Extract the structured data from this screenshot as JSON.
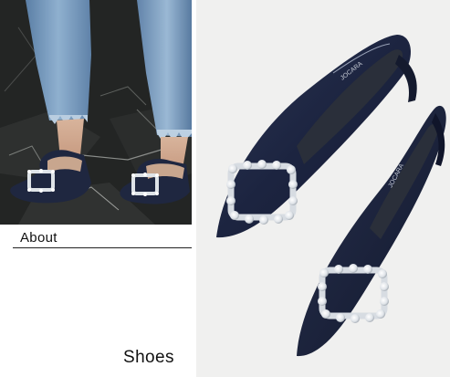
{
  "labels": {
    "about": "About",
    "shoes": "Shoes"
  },
  "images": {
    "street_photo": "worn-shoes-street-photo",
    "product_photo": "navy-pumps-product-photo"
  },
  "colors": {
    "navy": "#1f2740",
    "pavement": "#2a2c2b",
    "denim": "#6f93b8",
    "product_bg": "#f0f0ef"
  }
}
